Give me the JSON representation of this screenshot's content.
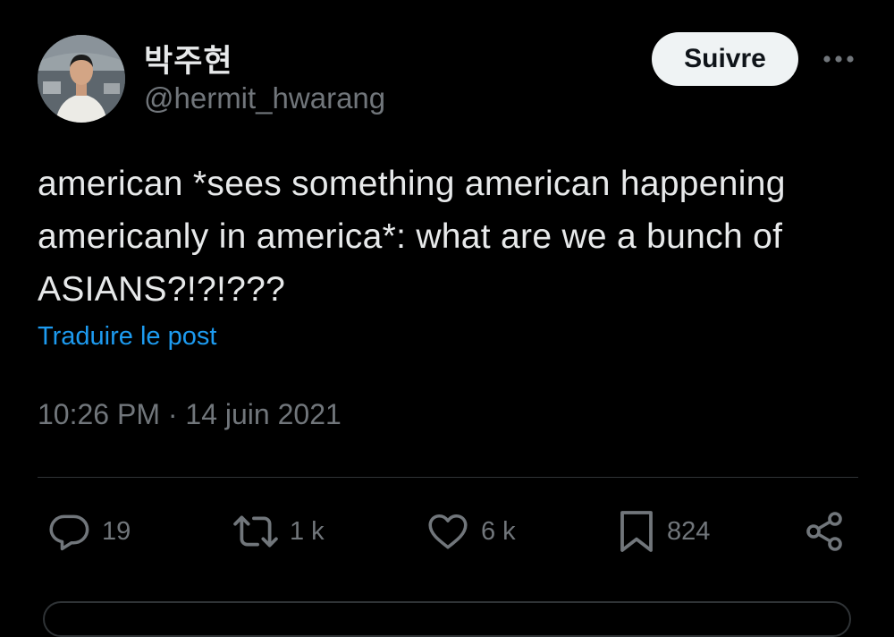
{
  "user": {
    "display_name": "박주현",
    "handle": "@hermit_hwarang",
    "avatar_icon": "profile-photo"
  },
  "header": {
    "follow_label": "Suivre",
    "more_icon": "more-horizontal-icon"
  },
  "tweet": {
    "text": "american *sees something american happening\namericanly in america*: what are we a bunch of\nASIANS?!?!???",
    "translate_label": "Traduire le post",
    "time": "10:26 PM",
    "separator": "·",
    "date": "14 juin 2021"
  },
  "actions": {
    "reply": {
      "icon": "reply-icon",
      "count": "19"
    },
    "retweet": {
      "icon": "retweet-icon",
      "count": "1 k"
    },
    "like": {
      "icon": "heart-icon",
      "count": "6 k"
    },
    "bookmark": {
      "icon": "bookmark-icon",
      "count": "824"
    },
    "share": {
      "icon": "share-icon"
    }
  },
  "colors": {
    "background": "#000000",
    "text": "#e7e9ea",
    "secondary": "#71767b",
    "link": "#1d9bf0",
    "divider": "#2f3336",
    "button_bg": "#eff3f4"
  }
}
